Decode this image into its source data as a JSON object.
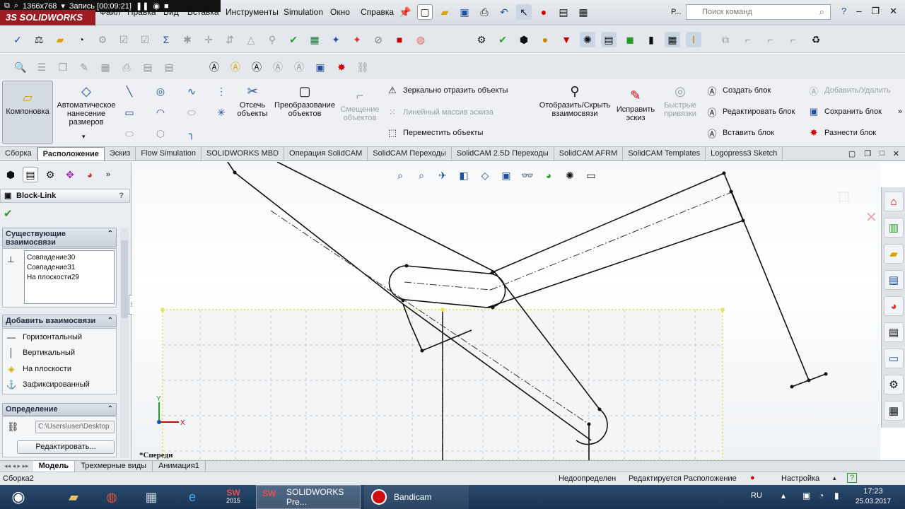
{
  "recorder": {
    "resolution": "1366x768",
    "recording": "Запись [00:09:21]"
  },
  "app": {
    "brand": "SOLIDWORKS",
    "brand_prefix": "3S"
  },
  "menu": [
    "Файл",
    "Правка",
    "Вид",
    "Вставка",
    "Инструменты",
    "Simulation",
    "Окно",
    "Справка"
  ],
  "search": {
    "placeholder": "Поиск команд",
    "prefix": "Р..."
  },
  "cmd": {
    "layout": "Компоновка",
    "autodim": "Автоматическое нанесение размеров",
    "trim": "Отсечь объекты",
    "convert": "Преобразование объектов",
    "offset": "Смещение объектов",
    "mirror": "Зеркально отразить объекты",
    "linear": "Линейный массив эскиза",
    "move": "Переместить объекты",
    "showhide": "Отобразить/Скрыть взаимосвязи",
    "repair": "Исправить эскиз",
    "snaps": "Быстрые привязки",
    "create_block": "Создать блок",
    "edit_block": "Редактировать блок",
    "insert_block": "Вставить блок",
    "add_remove": "Добавить/Удалить",
    "save_block": "Сохранить блок",
    "explode_block": "Разнести блок"
  },
  "tabs": [
    "Сборка",
    "Расположение",
    "Эскиз",
    "Flow Simulation",
    "SOLIDWORKS MBD",
    "Операция SolidCAM",
    "SolidCAM Переходы",
    "SolidCAM 2.5D Переходы",
    "SolidCAM AFRM",
    "SolidCAM Templates",
    "Logopress3 Sketch"
  ],
  "active_tab": "Расположение",
  "panel": {
    "title": "Block-Link",
    "help": "?",
    "existing_header": "Существующие взаимосвязи",
    "existing": [
      "Совпадение30",
      "Совпадение31",
      "На плоскости29"
    ],
    "add_header": "Добавить взаимосвязи",
    "add": [
      "Горизонтальный",
      "Вертикальный",
      "На плоскости",
      "Зафиксированный"
    ],
    "def_header": "Определение",
    "path": "C:\\Users\\user\\Desktop",
    "edit_button": "Редактировать..."
  },
  "viewport": {
    "view_label": "*Спереди",
    "axis_x": "X",
    "axis_y": "Y"
  },
  "bottom_tabs": [
    "Модель",
    "Трехмерные виды",
    "Анимация1"
  ],
  "active_bottom_tab": "Модель",
  "status": {
    "doc": "Сборка2",
    "state": "Недоопределен",
    "editing": "Редактируется Расположение",
    "units": "Настройка",
    "help": "?"
  },
  "taskbar": {
    "sw_label": "SOLIDWORKS Pre...",
    "bandicam": "Bandicam",
    "sw_year": "2015",
    "lang": "RU",
    "time": "17:23",
    "date": "25.03.2017"
  },
  "colors": {
    "brand": "#9e1b24",
    "taskbar": "#1a3454",
    "sketch_line": "#111111",
    "selection": "#e8e36a"
  }
}
